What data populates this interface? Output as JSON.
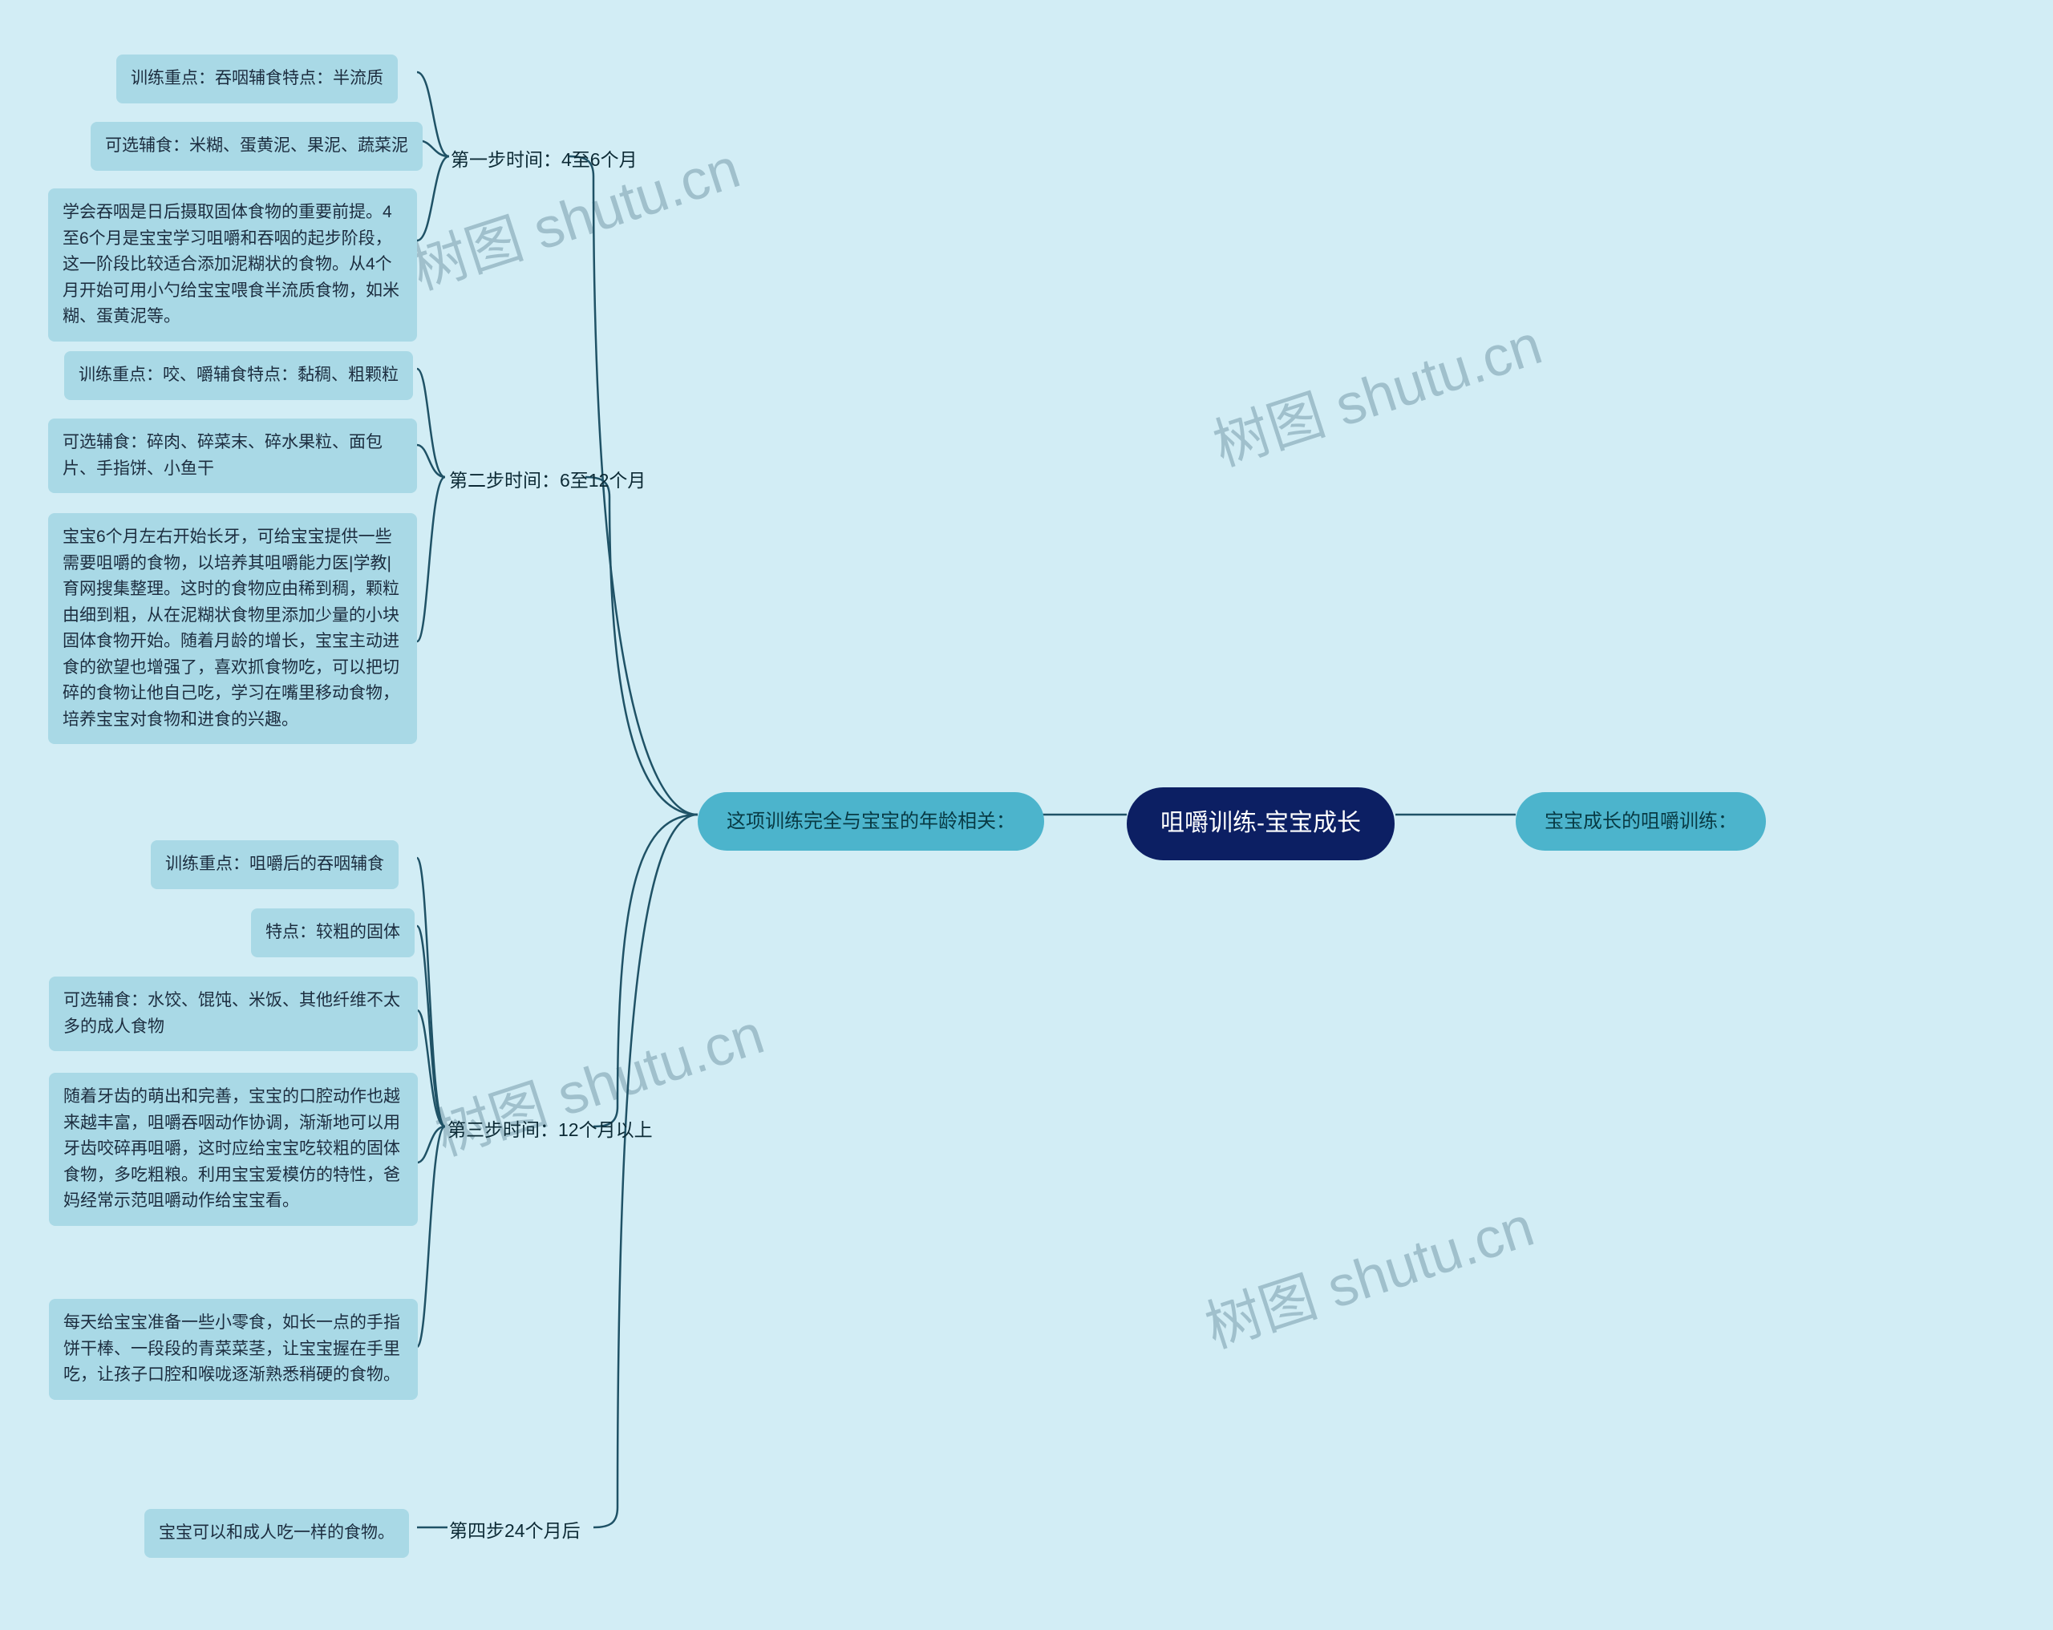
{
  "root": {
    "title": "咀嚼训练-宝宝成长"
  },
  "branches": {
    "right": {
      "label": "宝宝成长的咀嚼训练："
    },
    "left": {
      "label": "这项训练完全与宝宝的年龄相关：",
      "steps": [
        {
          "title": "第一步时间：4至6个月",
          "items": [
            "训练重点：吞咽辅食特点：半流质",
            "可选辅食：米糊、蛋黄泥、果泥、蔬菜泥",
            "学会吞咽是日后摄取固体食物的重要前提。4至6个月是宝宝学习咀嚼和吞咽的起步阶段，这一阶段比较适合添加泥糊状的食物。从4个月开始可用小勺给宝宝喂食半流质食物，如米糊、蛋黄泥等。"
          ]
        },
        {
          "title": "第二步时间：6至12个月",
          "items": [
            "训练重点：咬、嚼辅食特点：黏稠、粗颗粒",
            "可选辅食：碎肉、碎菜末、碎水果粒、面包片、手指饼、小鱼干",
            "宝宝6个月左右开始长牙，可给宝宝提供一些需要咀嚼的食物，以培养其咀嚼能力医|学教|育网搜集整理。这时的食物应由稀到稠，颗粒由细到粗，从在泥糊状食物里添加少量的小块固体食物开始。随着月龄的增长，宝宝主动进食的欲望也增强了，喜欢抓食物吃，可以把切碎的食物让他自己吃，学习在嘴里移动食物，培养宝宝对食物和进食的兴趣。"
          ]
        },
        {
          "title": "第三步时间：12个月以上",
          "items": [
            "训练重点：咀嚼后的吞咽辅食",
            "特点：较粗的固体",
            "可选辅食：水饺、馄饨、米饭、其他纤维不太多的成人食物",
            "随着牙齿的萌出和完善，宝宝的口腔动作也越来越丰富，咀嚼吞咽动作协调，渐渐地可以用牙齿咬碎再咀嚼，这时应给宝宝吃较粗的固体食物，多吃粗粮。利用宝宝爱模仿的特性，爸妈经常示范咀嚼动作给宝宝看。",
            "每天给宝宝准备一些小零食，如长一点的手指饼干棒、一段段的青菜菜茎，让宝宝握在手里吃，让孩子口腔和喉咙逐渐熟悉稍硬的食物。"
          ]
        },
        {
          "title": "第四步24个月后",
          "items": [
            "宝宝可以和成人吃一样的食物。"
          ]
        }
      ]
    }
  },
  "watermark": "树图 shutu.cn"
}
